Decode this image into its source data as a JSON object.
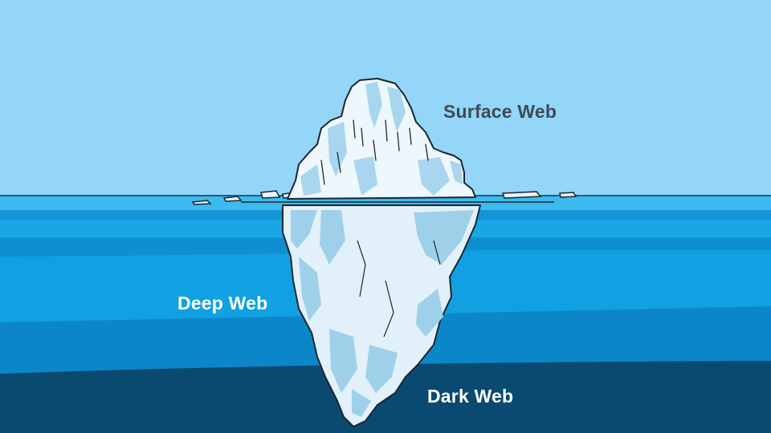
{
  "labels": {
    "surface": "Surface Web",
    "deep": "Deep Web",
    "dark": "Dark Web"
  },
  "colors": {
    "sky": "#93d6f8",
    "ocean_surface": "#1aa6e6",
    "ocean_mid": "#0c8fd6",
    "ocean_deep": "#0b74b2",
    "ocean_dark": "#0b4e74",
    "ice_light": "#e6f3fb",
    "ice_shadow": "#a8d4ec",
    "outline": "#1c2630"
  },
  "icons": {
    "iceberg": "iceberg-icon"
  }
}
